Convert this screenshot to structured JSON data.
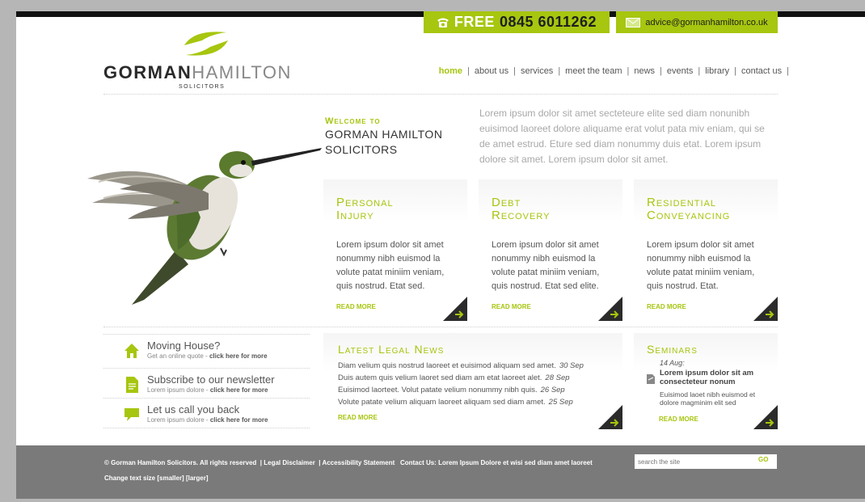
{
  "header": {
    "phone_free": "FREE",
    "phone_number": "0845 6011262",
    "email": "advice@gormanhamilton.co.uk",
    "logo_bold": "GORMAN",
    "logo_light": "HAMILTON",
    "logo_sub": "SOLICITORS"
  },
  "nav": {
    "items": [
      "home",
      "about us",
      "services",
      "meet the team",
      "news",
      "events",
      "library",
      "contact us"
    ],
    "active": "home"
  },
  "welcome": {
    "line1": "Welcome to",
    "line2": "GORMAN HAMILTON",
    "line3": "SOLICITORS",
    "intro": "Lorem ipsum dolor sit amet secteteure elite sed diam nonunibh euisimod laoreet dolore aliquame erat volut pata miv eniam, qui se de amet estrud. Eture sed diam nonummy duis etat. Lorem ipsum dolore sit amet. Lorem ipsum dolor sit amet."
  },
  "services": [
    {
      "title1": "Personal",
      "title2": "Injury",
      "text": "Lorem ipsum dolor sit amet nonummy nibh euismod la volute patat miniim veniam, quis nostrud. Etat sed.",
      "more": "READ MORE"
    },
    {
      "title1": "Debt",
      "title2": "Recovery",
      "text": "Lorem ipsum dolor sit amet nonummy nibh euismod la volute patat miniim veniam, quis nostrud. Etat sed elite.",
      "more": "READ MORE"
    },
    {
      "title1": "Residential",
      "title2": "Conveyancing",
      "text": "Lorem ipsum dolor sit amet nonummy nibh euismod la volute patat miniim veniam, quis nostrud. Etat.",
      "more": "READ MORE"
    }
  ],
  "quicklinks": [
    {
      "title": "Moving House?",
      "sub": "Get an online quote - ",
      "link": "click here for more",
      "icon": "house-icon"
    },
    {
      "title": "Subscribe to our newsletter",
      "sub": "Lorem ipsum dolore - ",
      "link": "click here for more",
      "icon": "document-icon"
    },
    {
      "title": "Let us call you back",
      "sub": "Lorem ipsum dolore - ",
      "link": "click here for more",
      "icon": "speech-bubble-icon"
    }
  ],
  "news": {
    "title": "Latest Legal News",
    "items": [
      {
        "text": "Diam velium quis nostrud laoreet et euisimod aliquam sed amet.",
        "date": "30 Sep"
      },
      {
        "text": "Duis autem quis velium laoret sed diam am etat laoreet alet.",
        "date": "28 Sep"
      },
      {
        "text": "Euisimod laorteet. Volut patate velium nonummy nibh quis.",
        "date": "26 Sep"
      },
      {
        "text": "Volute patate velium aliquam laoreet aliquam sed diam amet.",
        "date": "25 Sep"
      }
    ],
    "more": "READ MORE"
  },
  "seminars": {
    "title": "Seminars",
    "date": "14 Aug:",
    "item_title": "Lorem ipsum dolor sit am consecteteur nonum",
    "item_desc": "Euisimod laoet nibh euismod et dolore magminim elit sed",
    "more": "READ MORE"
  },
  "footer": {
    "copyright": "© Gorman Hamilton Solicitors.  All rights reserved",
    "disclaimer": "Legal Disclaimer",
    "accessibility": "Accessibility Statement",
    "contact": "Contact Us: Lorem Ipsum Dolore et wisi sed diam amet laoreet",
    "text_size_label": "Change text size",
    "smaller": "[smaller]",
    "larger": "[larger]",
    "search_placeholder": "search the site",
    "go": "GO"
  },
  "colors": {
    "accent": "#a6c60f",
    "footer": "#7a7a7a",
    "dark": "#111111"
  }
}
